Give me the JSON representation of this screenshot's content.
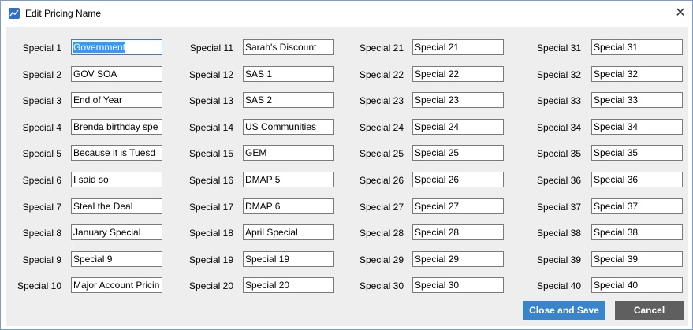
{
  "window": {
    "title": "Edit Pricing Name",
    "close_glyph": "✕",
    "icon": "app-chart-icon"
  },
  "fields": [
    {
      "label": "Special 1",
      "value": "Government"
    },
    {
      "label": "Special 2",
      "value": "GOV SOA"
    },
    {
      "label": "Special 3",
      "value": "End of Year"
    },
    {
      "label": "Special 4",
      "value": "Brenda birthday spe"
    },
    {
      "label": "Special 5",
      "value": "Because it is Tuesd"
    },
    {
      "label": "Special 6",
      "value": "I said so"
    },
    {
      "label": "Special 7",
      "value": "Steal the Deal"
    },
    {
      "label": "Special 8",
      "value": "January Special"
    },
    {
      "label": "Special 9",
      "value": "Special 9"
    },
    {
      "label": "Special 10",
      "value": "Major Account Pricin"
    },
    {
      "label": "Special 11",
      "value": "Sarah's Discount"
    },
    {
      "label": "Special 12",
      "value": "SAS 1"
    },
    {
      "label": "Special 13",
      "value": "SAS 2"
    },
    {
      "label": "Special 14",
      "value": "US Communities"
    },
    {
      "label": "Special 15",
      "value": "GEM"
    },
    {
      "label": "Special 16",
      "value": "DMAP 5"
    },
    {
      "label": "Special 17",
      "value": "DMAP 6"
    },
    {
      "label": "Special 18",
      "value": "April Special"
    },
    {
      "label": "Special 19",
      "value": "Special 19"
    },
    {
      "label": "Special 20",
      "value": "Special 20"
    },
    {
      "label": "Special 21",
      "value": "Special 21"
    },
    {
      "label": "Special 22",
      "value": "Special 22"
    },
    {
      "label": "Special 23",
      "value": "Special 23"
    },
    {
      "label": "Special 24",
      "value": "Special 24"
    },
    {
      "label": "Special 25",
      "value": "Special 25"
    },
    {
      "label": "Special 26",
      "value": "Special 26"
    },
    {
      "label": "Special 27",
      "value": "Special 27"
    },
    {
      "label": "Special 28",
      "value": "Special 28"
    },
    {
      "label": "Special 29",
      "value": "Special 29"
    },
    {
      "label": "Special 30",
      "value": "Special 30"
    },
    {
      "label": "Special 31",
      "value": "Special 31"
    },
    {
      "label": "Special 32",
      "value": "Special 32"
    },
    {
      "label": "Special 33",
      "value": "Special 33"
    },
    {
      "label": "Special 34",
      "value": "Special 34"
    },
    {
      "label": "Special 35",
      "value": "Special 35"
    },
    {
      "label": "Special 36",
      "value": "Special 36"
    },
    {
      "label": "Special 37",
      "value": "Special 37"
    },
    {
      "label": "Special 38",
      "value": "Special 38"
    },
    {
      "label": "Special 39",
      "value": "Special 39"
    },
    {
      "label": "Special 40",
      "value": "Special 40"
    }
  ],
  "buttons": {
    "save_label": "Close and Save",
    "cancel_label": "Cancel"
  },
  "colors": {
    "save": "#3a84c9",
    "cancel": "#5f5f5f",
    "focus_border": "#3d7bd0",
    "selection": "#3399ff"
  }
}
